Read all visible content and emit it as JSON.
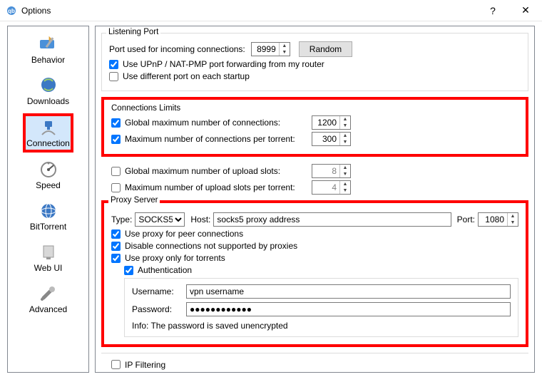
{
  "window": {
    "title": "Options"
  },
  "sidebar": {
    "items": [
      {
        "label": "Behavior"
      },
      {
        "label": "Downloads"
      },
      {
        "label": "Connection"
      },
      {
        "label": "Speed"
      },
      {
        "label": "BitTorrent"
      },
      {
        "label": "Web UI"
      },
      {
        "label": "Advanced"
      }
    ]
  },
  "listening": {
    "legend": "Listening Port",
    "port_label": "Port used for incoming connections:",
    "port_value": "8999",
    "random_label": "Random",
    "upnp_label": "Use UPnP / NAT-PMP port forwarding from my router",
    "upnp_checked": true,
    "diffport_label": "Use different port on each startup",
    "diffport_checked": false
  },
  "limits": {
    "legend": "Connections Limits",
    "rows": [
      {
        "label": "Global maximum number of connections:",
        "value": "1200",
        "checked": true,
        "enabled": true
      },
      {
        "label": "Maximum number of connections per torrent:",
        "value": "300",
        "checked": true,
        "enabled": true
      },
      {
        "label": "Global maximum number of upload slots:",
        "value": "8",
        "checked": false,
        "enabled": false
      },
      {
        "label": "Maximum number of upload slots per torrent:",
        "value": "4",
        "checked": false,
        "enabled": false
      }
    ]
  },
  "proxy": {
    "legend": "Proxy Server",
    "type_label": "Type:",
    "type_value": "SOCKS5",
    "host_label": "Host:",
    "host_value": "socks5 proxy address",
    "port_label": "Port:",
    "port_value": "1080",
    "peer_label": "Use proxy for peer connections",
    "peer_checked": true,
    "disable_unsupported_label": "Disable connections not supported by proxies",
    "disable_unsupported_checked": true,
    "only_torrents_label": "Use proxy only for torrents",
    "only_torrents_checked": true,
    "auth_label": "Authentication",
    "auth_checked": true,
    "username_label": "Username:",
    "username_value": "vpn username",
    "password_label": "Password:",
    "password_value": "●●●●●●●●●●●●",
    "info_label": "Info: The password is saved unencrypted"
  },
  "ipfilter": {
    "label": "IP Filtering"
  }
}
